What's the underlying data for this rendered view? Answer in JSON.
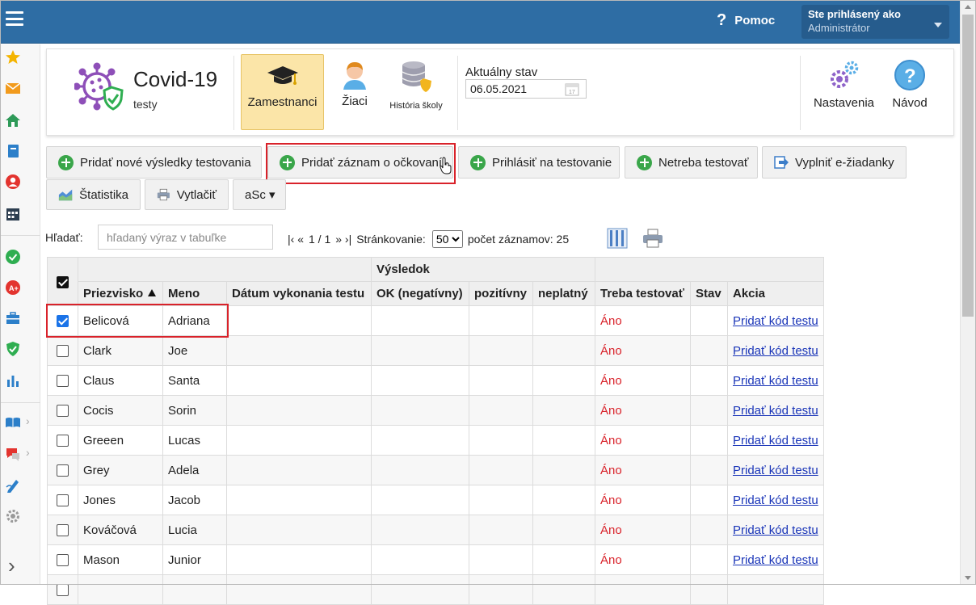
{
  "topbar": {
    "help_label": "Pomoc",
    "login_title": "Ste prihlásený ako",
    "login_user": "Administrátor"
  },
  "header": {
    "app_title": "Covid-19",
    "app_subtitle": "testy",
    "nav": [
      {
        "label": "Zamestnanci",
        "active": true
      },
      {
        "label": "Žiaci",
        "active": false
      },
      {
        "label": "História školy",
        "active": false
      }
    ],
    "date_label": "Aktuálny stav",
    "date_value": "06.05.2021",
    "settings_label": "Nastavenia",
    "guide_label": "Návod"
  },
  "toolbar": {
    "add_results": "Pridať nové výsledky testovania",
    "add_vaccination": "Pridať záznam o očkovaní",
    "register_testing": "Prihlásiť na testovanie",
    "no_testing": "Netreba testovať",
    "fill_requests": "Vyplniť e-žiadanky",
    "statistics": "Štatistika",
    "print": "Vytlačiť",
    "asc_menu": "aSc ▾"
  },
  "search": {
    "label": "Hľadať:",
    "placeholder": "hľadaný výraz v tabuľke"
  },
  "pager": {
    "nav_first_prev": "|‹ «",
    "page_info": "1 / 1",
    "nav_next_last": "» ›|",
    "paging_label": "Stránkovanie:",
    "page_size": "50",
    "count_label": "počet záznamov: 25"
  },
  "table": {
    "group_header": "Výsledok",
    "columns": {
      "surname": "Priezvisko",
      "name": "Meno",
      "date": "Dátum vykonania testu",
      "ok": "OK (negatívny)",
      "positive": "pozitívny",
      "invalid": "neplatný",
      "need_test": "Treba testovať",
      "status": "Stav",
      "action": "Akcia"
    },
    "rows": [
      {
        "checked": true,
        "surname": "Belicová",
        "name": "Adriana",
        "date": "",
        "ok": "",
        "positive": "",
        "invalid": "",
        "need_test": "Áno",
        "status": "",
        "action": "Pridať kód testu"
      },
      {
        "checked": false,
        "surname": "Clark",
        "name": "Joe",
        "date": "",
        "ok": "",
        "positive": "",
        "invalid": "",
        "need_test": "Áno",
        "status": "",
        "action": "Pridať kód testu"
      },
      {
        "checked": false,
        "surname": "Claus",
        "name": "Santa",
        "date": "",
        "ok": "",
        "positive": "",
        "invalid": "",
        "need_test": "Áno",
        "status": "",
        "action": "Pridať kód testu"
      },
      {
        "checked": false,
        "surname": "Cocis",
        "name": "Sorin",
        "date": "",
        "ok": "",
        "positive": "",
        "invalid": "",
        "need_test": "Áno",
        "status": "",
        "action": "Pridať kód testu"
      },
      {
        "checked": false,
        "surname": "Greeen",
        "name": "Lucas",
        "date": "",
        "ok": "",
        "positive": "",
        "invalid": "",
        "need_test": "Áno",
        "status": "",
        "action": "Pridať kód testu"
      },
      {
        "checked": false,
        "surname": "Grey",
        "name": "Adela",
        "date": "",
        "ok": "",
        "positive": "",
        "invalid": "",
        "need_test": "Áno",
        "status": "",
        "action": "Pridať kód testu"
      },
      {
        "checked": false,
        "surname": "Jones",
        "name": "Jacob",
        "date": "",
        "ok": "",
        "positive": "",
        "invalid": "",
        "need_test": "Áno",
        "status": "",
        "action": "Pridať kód testu"
      },
      {
        "checked": false,
        "surname": "Kováčová",
        "name": "Lucia",
        "date": "",
        "ok": "",
        "positive": "",
        "invalid": "",
        "need_test": "Áno",
        "status": "",
        "action": "Pridať kód testu"
      },
      {
        "checked": false,
        "surname": "Mason",
        "name": "Junior",
        "date": "",
        "ok": "",
        "positive": "",
        "invalid": "",
        "need_test": "Áno",
        "status": "",
        "action": "Pridať kód testu"
      },
      {
        "checked": false,
        "surname": "",
        "name": "",
        "date": "",
        "ok": "",
        "positive": "",
        "invalid": "",
        "need_test": "",
        "status": "",
        "action": ""
      }
    ]
  },
  "colors": {
    "topbar": "#2e6da4",
    "active_tile": "#fbe5a8",
    "highlight": "#d9222a",
    "link": "#1a35b8",
    "plus_green": "#3aa64a"
  },
  "rail_icons": [
    "star-icon",
    "mail-icon",
    "home-icon",
    "notebook-icon",
    "user-icon",
    "calendar-icon",
    "check-icon",
    "grade-icon",
    "briefcase-icon",
    "shield-icon",
    "bar-chart-icon",
    "book-icon",
    "chat-icon",
    "pen-icon",
    "gear-icon",
    "chevron-right-icon"
  ]
}
